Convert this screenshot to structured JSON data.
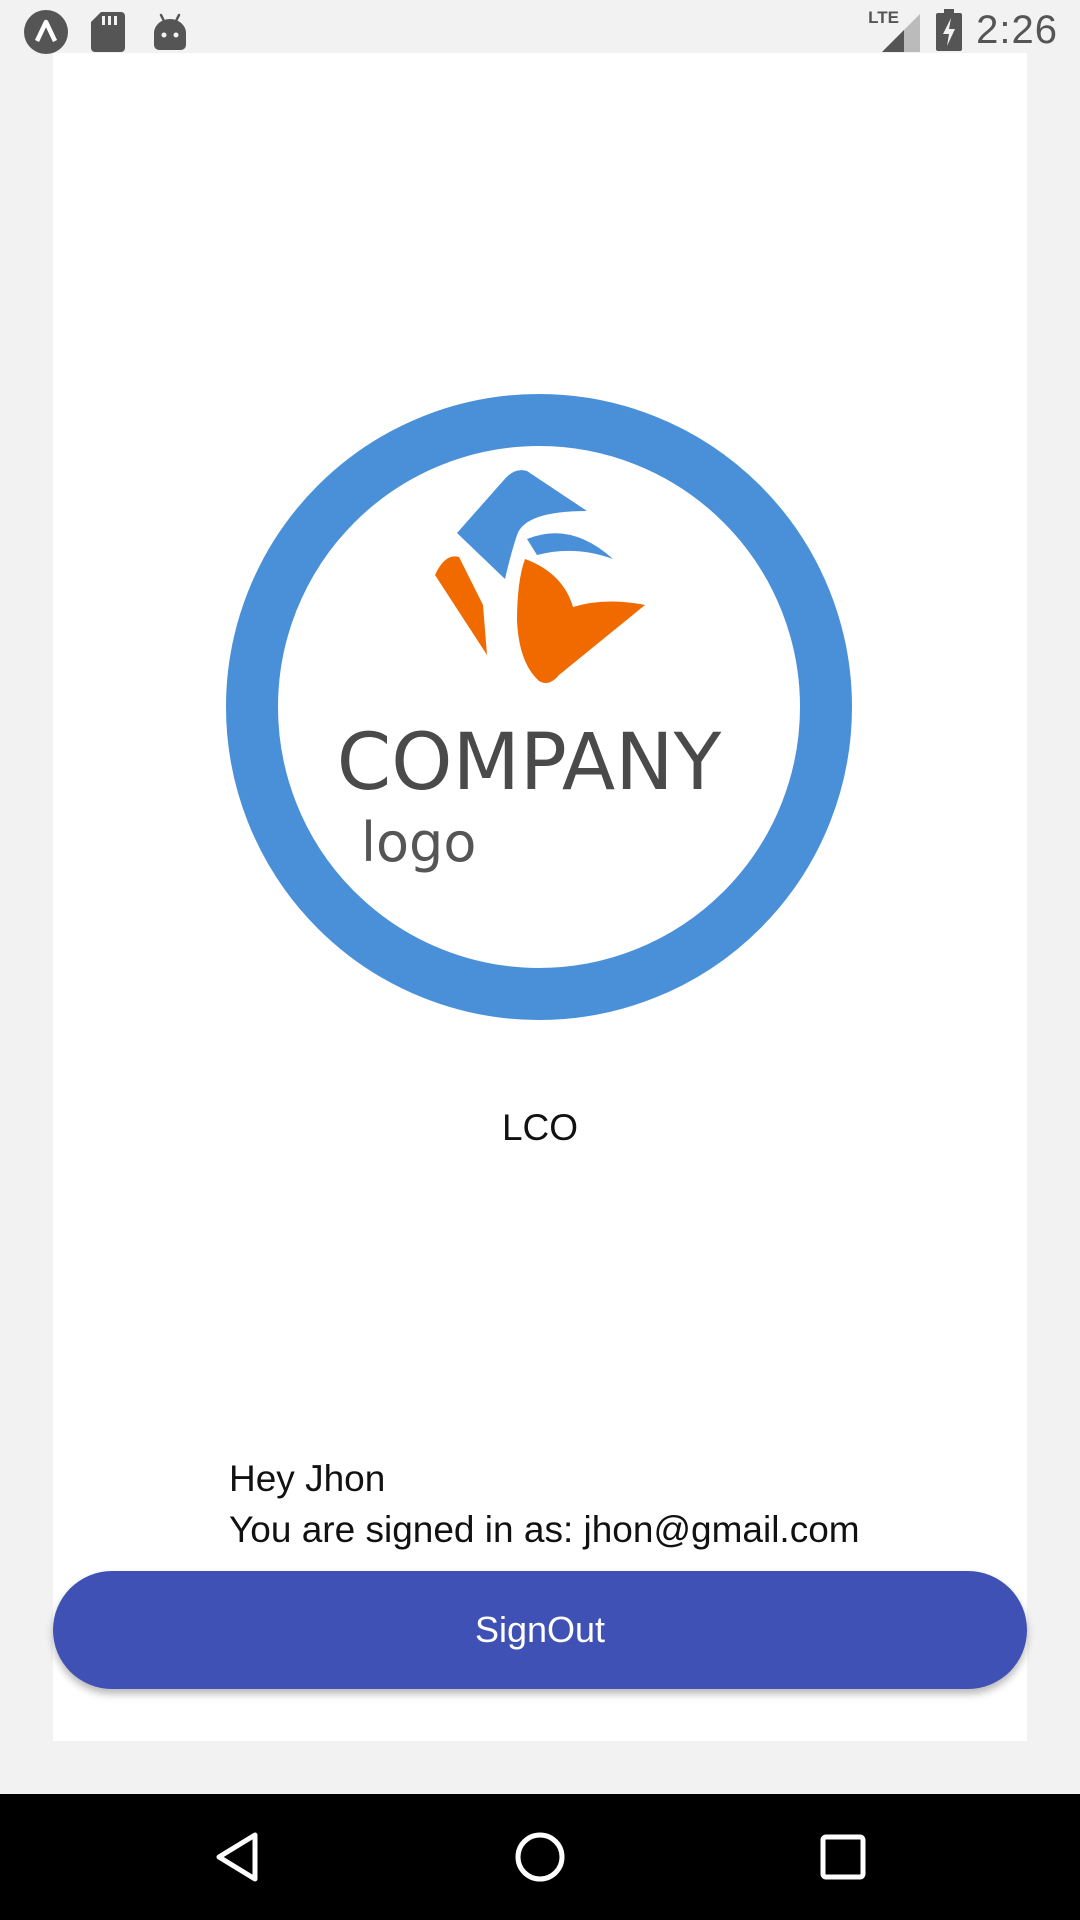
{
  "status_bar": {
    "time": "2:26",
    "network_label": "LTE",
    "left_icons": [
      "app-launcher-icon",
      "sd-card-icon",
      "android-icon"
    ],
    "right_icons": [
      "lte-signal-icon",
      "battery-charging-icon"
    ]
  },
  "logo": {
    "word_main": "COMPANY",
    "word_sub": "logo",
    "ring_color": "#4a90d9",
    "orange_color": "#f06a00",
    "text_color": "#4a4a4a"
  },
  "app_name": "LCO",
  "greeting": {
    "line1": "Hey Jhon",
    "line2": "You are signed in as: jhon@gmail.com"
  },
  "signout_button": {
    "label": "SignOut",
    "color": "#3f51b5"
  },
  "nav_bar": {
    "icons": [
      "back-icon",
      "home-icon",
      "recents-icon"
    ]
  }
}
